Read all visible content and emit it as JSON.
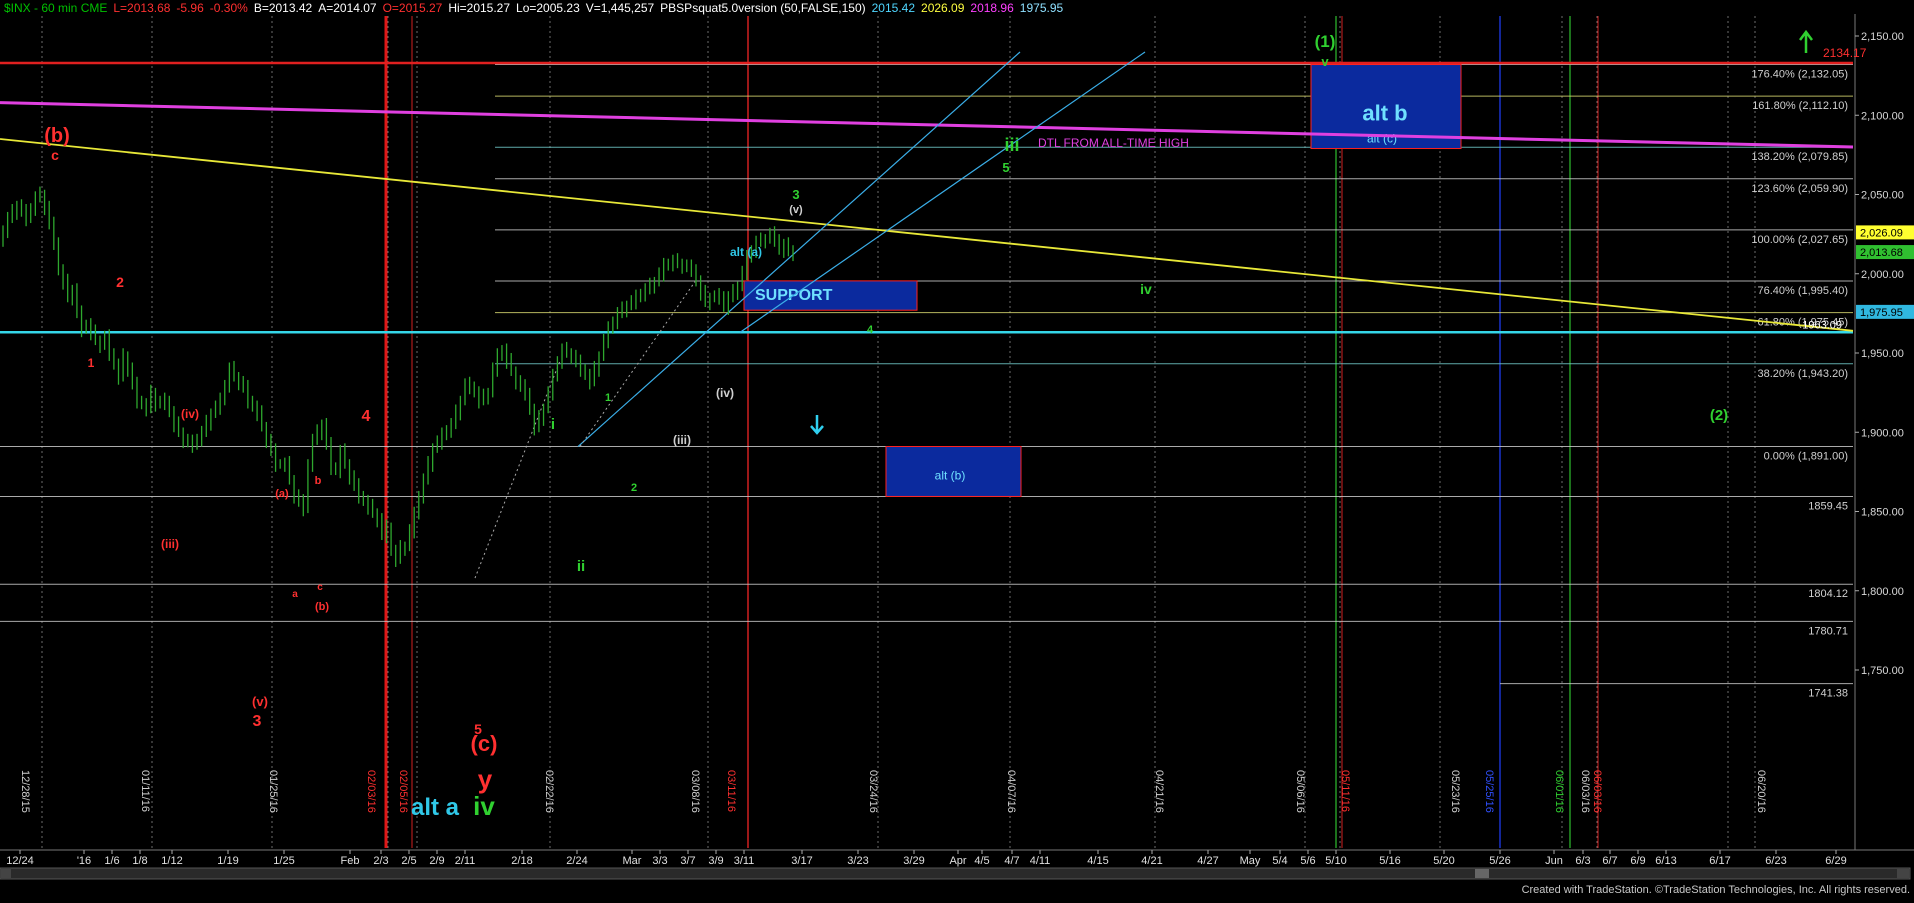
{
  "header": {
    "parts": [
      {
        "text": "$INX - 60 min  CME",
        "color": "#00c000"
      },
      {
        "text": "L=2013.68",
        "color": "#ff3030"
      },
      {
        "text": "-5.96",
        "color": "#ff3030"
      },
      {
        "text": "-0.30%",
        "color": "#ff3030"
      },
      {
        "text": "B=2013.42",
        "color": "#ffffff"
      },
      {
        "text": "A=2014.07",
        "color": "#ffffff"
      },
      {
        "text": "O=2015.27",
        "color": "#ff3030"
      },
      {
        "text": "Hi=2015.27",
        "color": "#ffffff"
      },
      {
        "text": "Lo=2005.23",
        "color": "#ffffff"
      },
      {
        "text": "V=1,445,257",
        "color": "#ffffff"
      },
      {
        "text": "PBSPsquat5.0version (50,FALSE,150)",
        "color": "#ffffff"
      },
      {
        "text": "2015.42",
        "color": "#4fd6ff"
      },
      {
        "text": "2026.09",
        "color": "#ffff40"
      },
      {
        "text": "2018.96",
        "color": "#ff40ff"
      },
      {
        "text": "1975.95",
        "color": "#8fe0ff"
      }
    ]
  },
  "footer": {
    "credit": "Created with TradeStation. ©TradeStation Technologies, Inc. All rights reserved."
  },
  "colors": {
    "background": "#000000",
    "bars": "#2ea82e",
    "fib_lines": "#d8d8d8",
    "support_cyan": "#35d6e8",
    "trend_yellow": "#e8e838",
    "trend_magenta": "#e040e0",
    "channel": "#3aaee8",
    "red_line": "#e02020",
    "box_fill": "#0b2a9e"
  },
  "chart_data": {
    "type": "line",
    "ylim": [
      1730,
      2160
    ],
    "x_dates": [
      "12/24",
      "'16",
      "1/6",
      "1/8",
      "1/12",
      "1/19",
      "1/25",
      "Feb",
      "2/3",
      "2/5",
      "2/9",
      "2/11",
      "2/18",
      "2/24",
      "Mar",
      "3/3",
      "3/7",
      "3/9",
      "3/11",
      "3/17",
      "3/23",
      "3/29",
      "Apr",
      "4/5",
      "4/7",
      "4/11",
      "4/15",
      "4/21",
      "4/27",
      "May",
      "5/4",
      "5/6",
      "5/10",
      "5/16",
      "5/20",
      "5/26",
      "Jun",
      "6/3",
      "6/7",
      "6/9",
      "6/13",
      "6/17",
      "6/23",
      "6/29"
    ],
    "y_ticks": [
      "2,150.00",
      "2,100.00",
      "2,050.00",
      "2,000.00",
      "1,950.00",
      "1,900.00",
      "1,850.00",
      "1,800.00",
      "1,750.00"
    ],
    "price_series": {
      "name": "$INX",
      "points": [
        [
          0,
          2020
        ],
        [
          2,
          2035
        ],
        [
          4,
          2043
        ],
        [
          6,
          2035
        ],
        [
          8,
          2048
        ],
        [
          9,
          2050
        ],
        [
          10,
          2042
        ],
        [
          12,
          2020
        ],
        [
          13,
          2002
        ],
        [
          14,
          1995
        ],
        [
          15,
          1985
        ],
        [
          16,
          1990
        ],
        [
          17,
          1975
        ],
        [
          18,
          1965
        ],
        [
          19,
          1968
        ],
        [
          21,
          1958
        ],
        [
          22,
          1955
        ],
        [
          23,
          1960
        ],
        [
          24,
          1950
        ],
        [
          26,
          1935
        ],
        [
          27,
          1948
        ],
        [
          28,
          1940
        ],
        [
          30,
          1920
        ],
        [
          32,
          1915
        ],
        [
          33,
          1925
        ],
        [
          34,
          1918
        ],
        [
          36,
          1920
        ],
        [
          38,
          1905
        ],
        [
          40,
          1895
        ],
        [
          42,
          1892
        ],
        [
          44,
          1900
        ],
        [
          46,
          1912
        ],
        [
          48,
          1920
        ],
        [
          49,
          1930
        ],
        [
          50,
          1940
        ],
        [
          51,
          1935
        ],
        [
          53,
          1928
        ],
        [
          54,
          1920
        ],
        [
          56,
          1912
        ],
        [
          58,
          1895
        ],
        [
          59,
          1888
        ],
        [
          60,
          1880
        ],
        [
          62,
          1880
        ],
        [
          64,
          1860
        ],
        [
          66,
          1852
        ],
        [
          67,
          1880
        ],
        [
          68,
          1895
        ],
        [
          70,
          1905
        ],
        [
          71,
          1892
        ],
        [
          72,
          1878
        ],
        [
          73,
          1876
        ],
        [
          74,
          1888
        ],
        [
          75,
          1880
        ],
        [
          76,
          1872
        ],
        [
          78,
          1860
        ],
        [
          80,
          1853
        ],
        [
          82,
          1845
        ],
        [
          83,
          1835
        ],
        [
          84,
          1840
        ],
        [
          85,
          1825
        ],
        [
          86,
          1820
        ],
        [
          87,
          1827
        ],
        [
          88,
          1828
        ],
        [
          90,
          1848
        ],
        [
          91,
          1860
        ],
        [
          92,
          1870
        ],
        [
          93,
          1880
        ],
        [
          94,
          1890
        ],
        [
          96,
          1898
        ],
        [
          98,
          1905
        ],
        [
          100,
          1920
        ],
        [
          101,
          1930
        ],
        [
          102,
          1929
        ],
        [
          103,
          1925
        ],
        [
          104,
          1920
        ],
        [
          106,
          1925
        ],
        [
          107,
          1940
        ],
        [
          108,
          1948
        ],
        [
          109,
          1952
        ],
        [
          110,
          1945
        ],
        [
          112,
          1932
        ],
        [
          114,
          1925
        ],
        [
          116,
          1903
        ],
        [
          118,
          1915
        ],
        [
          120,
          1935
        ],
        [
          121,
          1945
        ],
        [
          122,
          1952
        ],
        [
          124,
          1948
        ],
        [
          126,
          1940
        ],
        [
          128,
          1932
        ],
        [
          129,
          1940
        ],
        [
          130,
          1948
        ],
        [
          131,
          1958
        ],
        [
          132,
          1965
        ],
        [
          134,
          1975
        ],
        [
          136,
          1980
        ],
        [
          138,
          1985
        ],
        [
          140,
          1990
        ],
        [
          142,
          1995
        ],
        [
          144,
          2005
        ],
        [
          146,
          2008
        ],
        [
          148,
          2005
        ],
        [
          150,
          2003
        ],
        [
          151,
          1995
        ],
        [
          152,
          1988
        ],
        [
          153,
          1982
        ],
        [
          154,
          1985
        ],
        [
          156,
          1986
        ],
        [
          157,
          1979
        ],
        [
          158,
          1985
        ],
        [
          160,
          1992
        ],
        [
          162,
          2010
        ],
        [
          163,
          2015
        ],
        [
          164,
          2020
        ],
        [
          166,
          2022
        ],
        [
          167,
          2025
        ],
        [
          168,
          2022
        ],
        [
          169,
          2015
        ],
        [
          170,
          2018
        ],
        [
          171,
          2014
        ]
      ]
    },
    "horizontal_levels": [
      {
        "value": 2132.05,
        "label": "176.40% (2,132.05)"
      },
      {
        "value": 2112.1,
        "label": "161.80% (2,112.10)"
      },
      {
        "value": 2079.85,
        "label": "138.20% (2,079.85)"
      },
      {
        "value": 2059.9,
        "label": "123.60% (2,059.90)"
      },
      {
        "value": 2027.65,
        "label": "100.00% (2,027.65)"
      },
      {
        "value": 1995.4,
        "label": "76.40% (1,995.40)"
      },
      {
        "value": 1975.45,
        "label": "61.80% (1,975.45)"
      },
      {
        "value": 1943.2,
        "label": "38.20% (1,943.20)"
      },
      {
        "value": 1891.0,
        "label": "0.00% (1,891.00)"
      },
      {
        "value": 1859.45,
        "label": "1859.45"
      },
      {
        "value": 1804.12,
        "label": "1804.12"
      },
      {
        "value": 1780.71,
        "label": "1780.71"
      },
      {
        "value": 1741.38,
        "label": "1741.38"
      }
    ],
    "price_tags": [
      {
        "value": 2133.0,
        "label": "2134.17",
        "color": "#ff2020",
        "text": "#ffffff"
      },
      {
        "value": 2026.09,
        "label": "2,026.09",
        "color": "#ffff30",
        "text": "#000000"
      },
      {
        "value": 2013.68,
        "label": "2,013.68",
        "color": "#30c030",
        "text": "#000000"
      },
      {
        "value": 1975.95,
        "label": "1,975.95",
        "color": "#30b8e0",
        "text": "#000000"
      },
      {
        "value": 1963.09,
        "label": "1963.09",
        "color": "#000000",
        "text": "#ffffff"
      }
    ],
    "rotated_dates": [
      {
        "text": "12/28/15",
        "color": "#d0d0d0"
      },
      {
        "text": "01/11/16",
        "color": "#d0d0d0"
      },
      {
        "text": "01/25/16",
        "color": "#d0d0d0"
      },
      {
        "text": "02/03/16",
        "color": "#ff3030"
      },
      {
        "text": "02/05/16",
        "color": "#ff3030"
      },
      {
        "text": "02/22/16",
        "color": "#d0d0d0"
      },
      {
        "text": "03/08/16",
        "color": "#d0d0d0"
      },
      {
        "text": "03/11/16",
        "color": "#ff3030"
      },
      {
        "text": "03/24/16",
        "color": "#d0d0d0"
      },
      {
        "text": "04/07/16",
        "color": "#d0d0d0"
      },
      {
        "text": "04/21/16",
        "color": "#d0d0d0"
      },
      {
        "text": "05/06/16",
        "color": "#d0d0d0"
      },
      {
        "text": "05/11/16",
        "color": "#ff3030"
      },
      {
        "text": "05/23/16",
        "color": "#d0d0d0"
      },
      {
        "text": "05/25/16",
        "color": "#3050ff"
      },
      {
        "text": "06/01/16",
        "color": "#30d030"
      },
      {
        "text": "06/03/16",
        "color": "#d0d0d0"
      },
      {
        "text": "06/03/16",
        "color": "#ff3030"
      },
      {
        "text": "06/20/16",
        "color": "#d0d0d0"
      }
    ],
    "boxes": [
      {
        "label": "SUPPORT"
      },
      {
        "label": "alt (b)"
      },
      {
        "label": "alt b",
        "sublabel": "alt (c)"
      }
    ],
    "trendline_labels": [
      "DTL FROM ALL-TIME HIGH"
    ],
    "wave_labels": [
      {
        "text": "(b)",
        "color": "#ff3030"
      },
      {
        "text": "c",
        "color": "#ff3030"
      },
      {
        "text": "2",
        "color": "#ff3030"
      },
      {
        "text": "1",
        "color": "#ff3030"
      },
      {
        "text": "(iv)",
        "color": "#ff3030"
      },
      {
        "text": "(iii)",
        "color": "#ff3030"
      },
      {
        "text": "(v)",
        "color": "#ff3030"
      },
      {
        "text": "3",
        "color": "#ff3030"
      },
      {
        "text": "(a)",
        "color": "#ff3030"
      },
      {
        "text": "b",
        "color": "#ff3030"
      },
      {
        "text": "a",
        "color": "#ff3030"
      },
      {
        "text": "c",
        "color": "#ff3030"
      },
      {
        "text": "(b)",
        "color": "#ff3030"
      },
      {
        "text": "4",
        "color": "#ff3030"
      },
      {
        "text": "5",
        "color": "#ff3030"
      },
      {
        "text": "(c)",
        "color": "#ff3030"
      },
      {
        "text": "y",
        "color": "#ff3030"
      },
      {
        "text": "alt a",
        "color": "#30c8e8"
      },
      {
        "text": "iv",
        "color": "#30d030"
      },
      {
        "text": "i",
        "color": "#30d030"
      },
      {
        "text": "ii",
        "color": "#30d030"
      },
      {
        "text": "1",
        "color": "#30d030"
      },
      {
        "text": "2",
        "color": "#30d030"
      },
      {
        "text": "(iii)",
        "color": "#d0d0d0"
      },
      {
        "text": "(iv)",
        "color": "#d0d0d0"
      },
      {
        "text": "alt (a)",
        "color": "#30c8e8"
      },
      {
        "text": "3",
        "color": "#30d030"
      },
      {
        "text": "(v)",
        "color": "#d0d0d0"
      },
      {
        "text": "4",
        "color": "#30d030"
      },
      {
        "text": "iii",
        "color": "#30d030"
      },
      {
        "text": "5",
        "color": "#30d030"
      },
      {
        "text": "iv",
        "color": "#30d030"
      },
      {
        "text": "(1)",
        "color": "#30d030"
      },
      {
        "text": "v",
        "color": "#30d030"
      },
      {
        "text": "(2)",
        "color": "#30d030"
      }
    ]
  }
}
